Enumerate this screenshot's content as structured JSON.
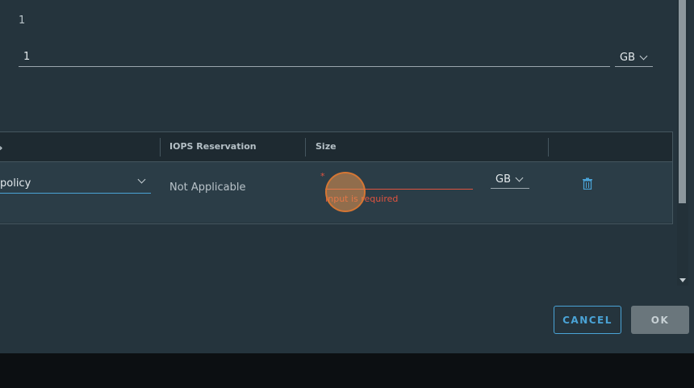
{
  "form": {
    "top_value": "1",
    "capacity_value": "1",
    "capacity_unit": "GB"
  },
  "table": {
    "headers": [
      "",
      "IOPS Reservation",
      "Size"
    ],
    "row": {
      "policy": "policy",
      "iops": "Not Applicable",
      "size_placeholder": "",
      "size_required_mark": "*",
      "size_error": "Input is required",
      "size_unit": "GB"
    }
  },
  "icons": {
    "delete": "trash-icon",
    "dropdown": "chevron-down-icon",
    "scroll_down": "scroll-down-arrow-icon"
  },
  "buttons": {
    "cancel": "CANCEL",
    "ok": "OK"
  },
  "colors": {
    "dialog_bg": "#25343d",
    "accent": "#4aa3d6",
    "error": "#e0533f"
  }
}
